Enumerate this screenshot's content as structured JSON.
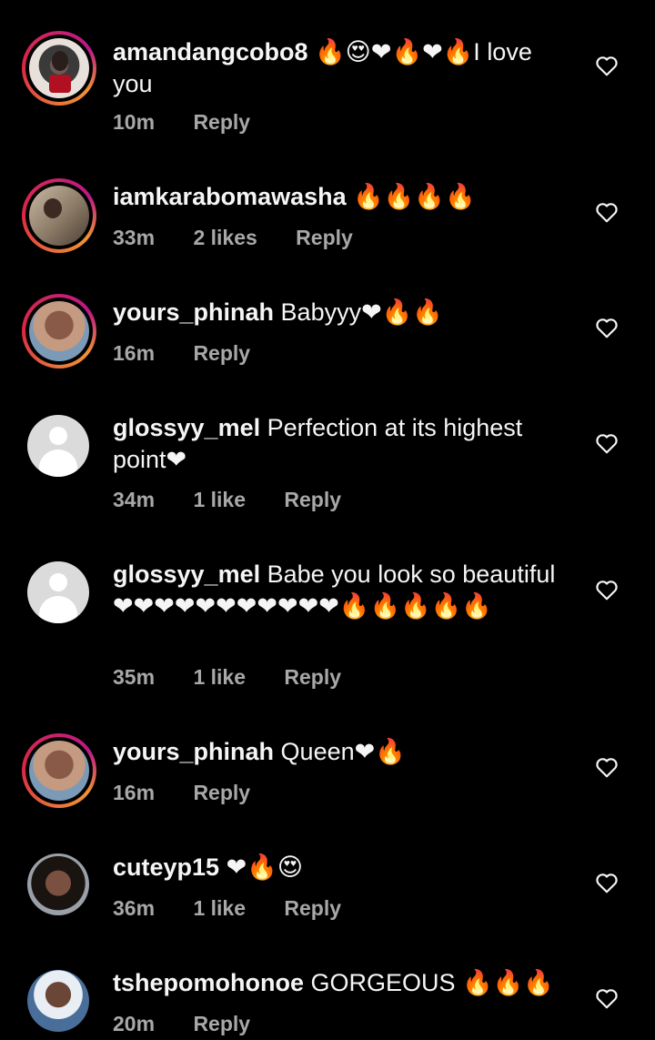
{
  "comments": [
    {
      "username": "amandangcobo8",
      "text": "🔥😍❤🔥❤🔥I love you",
      "time": "10m",
      "likes": "",
      "reply": "Reply",
      "avatar": "photo"
    },
    {
      "username": "iamkarabomawasha",
      "text": "🔥🔥🔥🔥",
      "time": "33m",
      "likes": "2 likes",
      "reply": "Reply",
      "avatar": "photo"
    },
    {
      "username": "yours_phinah",
      "text": "Babyyy❤🔥🔥",
      "time": "16m",
      "likes": "",
      "reply": "Reply",
      "avatar": "photo"
    },
    {
      "username": "glossyy_mel",
      "text": "Perfection at its highest point❤",
      "time": "34m",
      "likes": "1 like",
      "reply": "Reply",
      "avatar": "default"
    },
    {
      "username": "glossyy_mel",
      "text": "Babe you look so beautiful ❤❤❤❤❤❤❤❤❤❤❤🔥🔥🔥🔥🔥",
      "time": "35m",
      "likes": "1 like",
      "reply": "Reply",
      "avatar": "default"
    },
    {
      "username": "yours_phinah",
      "text": "Queen❤🔥",
      "time": "16m",
      "likes": "",
      "reply": "Reply",
      "avatar": "photo"
    },
    {
      "username": "cuteyp15",
      "text": "❤🔥😍",
      "time": "36m",
      "likes": "1 like",
      "reply": "Reply",
      "avatar": "photo"
    },
    {
      "username": "tshepomohonoe",
      "text": "GORGEOUS 🔥🔥🔥",
      "time": "20m",
      "likes": "",
      "reply": "Reply",
      "avatar": "photo"
    }
  ],
  "icons": {
    "like": "heart-outline-icon",
    "default_avatar": "default-profile-icon"
  },
  "colors": {
    "background": "#000000",
    "text": "#f5f5f5",
    "meta": "#a8a8a8",
    "story_ring": "#dc2743"
  }
}
